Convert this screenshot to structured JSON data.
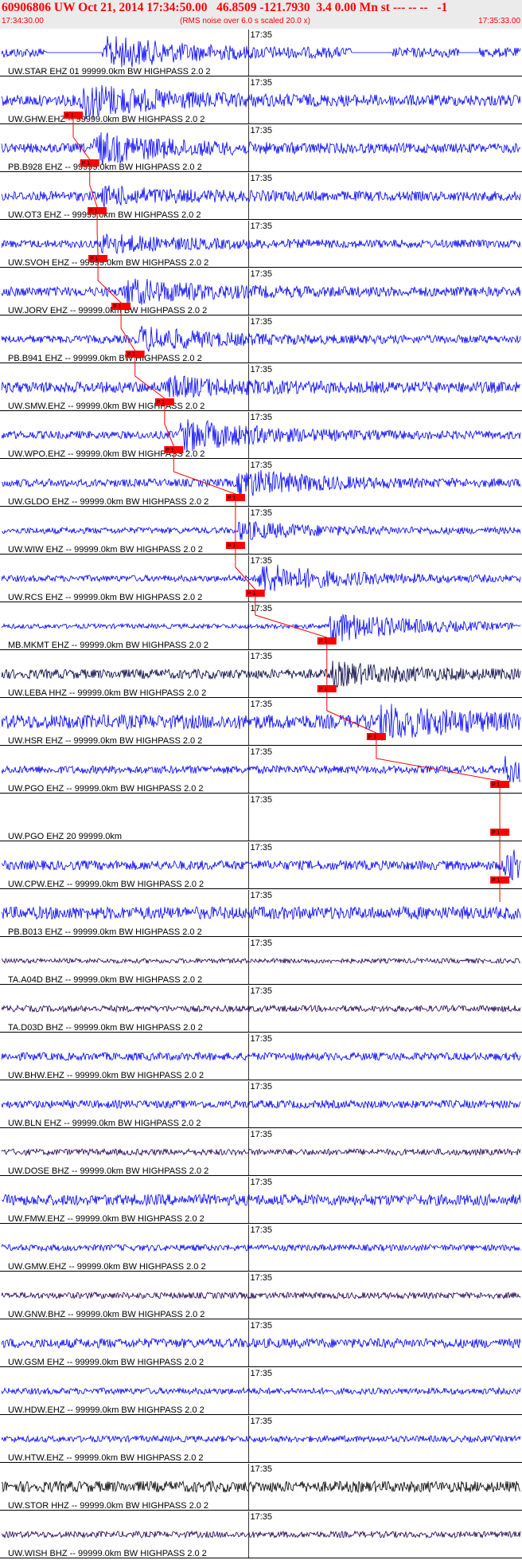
{
  "header": {
    "title": "60906806 UW Oct 21, 2014 17:34:50.00   46.8509 -121.7930  3.4 0.00 Mn st --- -- --   -1",
    "start_time": "17:34:30.00",
    "rms_note": "(RMS noise over 6.0 s scaled 20.0 x)",
    "end_time": "17:35:33.00"
  },
  "chart_data": {
    "type": "line",
    "time_range": [
      "17:34:30.00",
      "17:35:33.00"
    ],
    "time_mark": "17:35",
    "time_mark_offset_s": 30,
    "pick_marker": "P 1",
    "colors": {
      "trace_blue": "#0000ff",
      "trace_dark": "#000040",
      "trace_navy": "#200050",
      "pick": "#ff0000",
      "grid": "#000000"
    },
    "traces": [
      {
        "label": "UW.STAR EHZ 01 99999.0km BW  HIGHPASS  2.0  2",
        "pick_s": null,
        "onset_s": 12.5,
        "amp": 0.9,
        "noise": 0.3,
        "color": "#0000ff",
        "gaps": [
          [
            5.5,
            12.2
          ],
          [
            42.5,
            47.5
          ],
          [
            55.5,
            58
          ]
        ]
      },
      {
        "label": "UW.GHW.EHZ -- 99999.0km BW  HIGHPASS  2.0  2",
        "pick_s": 8.7,
        "onset_s": 9.5,
        "amp": 1.0,
        "noise": 0.35,
        "color": "#0000ff",
        "gaps": []
      },
      {
        "label": "PB.B928 EHZ -- 99999.0km BW  HIGHPASS  2.0  2",
        "pick_s": 10.7,
        "onset_s": 11.0,
        "amp": 0.9,
        "noise": 0.3,
        "color": "#0000ff",
        "gaps": []
      },
      {
        "label": "UW.OT3 EHZ -- 99999.0km BW  HIGHPASS  2.0  2",
        "pick_s": 11.6,
        "onset_s": 12.0,
        "amp": 0.45,
        "noise": 0.3,
        "color": "#0000ff",
        "gaps": []
      },
      {
        "label": "UW.SVOH EHZ -- 99999.0km BW  HIGHPASS  2.0  2",
        "pick_s": 11.7,
        "onset_s": 11.9,
        "amp": 0.5,
        "noise": 0.25,
        "color": "#0000ff",
        "gaps": []
      },
      {
        "label": "UW.JORV EHZ -- 99999.0km BW  HIGHPASS  2.0  2",
        "pick_s": 14.5,
        "onset_s": 14.7,
        "amp": 0.7,
        "noise": 0.3,
        "color": "#0000ff",
        "gaps": []
      },
      {
        "label": "PB.B941 EHZ -- 99999.0km BW  HIGHPASS  2.0  2",
        "pick_s": 16.2,
        "onset_s": 16.5,
        "amp": 0.7,
        "noise": 0.25,
        "color": "#0000ff",
        "gaps": []
      },
      {
        "label": "UW.SMW.EHZ -- 99999.0km BW  HIGHPASS  2.0  2",
        "pick_s": 19.8,
        "onset_s": 20.0,
        "amp": 0.45,
        "noise": 0.35,
        "color": "#0000ff",
        "gaps": []
      },
      {
        "label": "UW.WPO.EHZ -- 99999.0km BW  HIGHPASS  2.0  2",
        "pick_s": 20.9,
        "onset_s": 21.5,
        "amp": 0.95,
        "noise": 0.25,
        "color": "#0000ff",
        "gaps": []
      },
      {
        "label": "UW.GLDO EHZ -- 99999.0km BW  HIGHPASS  2.0  2",
        "pick_s": 28.4,
        "onset_s": 28.5,
        "amp": 0.8,
        "noise": 0.25,
        "color": "#0000ff",
        "gaps": []
      },
      {
        "label": "UW.WIW EHZ -- 99999.0km BW  HIGHPASS  2.0  2",
        "pick_s": 28.4,
        "onset_s": 28.5,
        "amp": 0.5,
        "noise": 0.2,
        "color": "#0000ff",
        "gaps": []
      },
      {
        "label": "UW.RCS EHZ -- 99999.0km BW  HIGHPASS  2.0  2",
        "pick_s": 30.8,
        "onset_s": 31.0,
        "amp": 0.9,
        "noise": 0.2,
        "color": "#0000ff",
        "gaps": []
      },
      {
        "label": "MB.MKMT EHZ -- 99999.0km BW  HIGHPASS  2.0  2",
        "pick_s": 39.5,
        "onset_s": 39.7,
        "amp": 1.0,
        "noise": 0.15,
        "color": "#0000ff",
        "gaps": []
      },
      {
        "label": "UW.LEBA HHZ -- 99999.0km BW  HIGHPASS  2.0  2",
        "pick_s": 39.5,
        "onset_s": 39.7,
        "amp": 0.6,
        "noise": 0.3,
        "color": "#000040",
        "gaps": []
      },
      {
        "label": "UW.HSR EHZ -- 99999.0km BW  HIGHPASS  2.0  2",
        "pick_s": 45.5,
        "onset_s": 45.8,
        "amp": 0.9,
        "noise": 0.45,
        "color": "#0000ff",
        "gaps": []
      },
      {
        "label": "UW.PGO EHZ -- 99999.0km BW  HIGHPASS  2.0  2",
        "pick_s": 60.5,
        "onset_s": 60.8,
        "amp": 0.7,
        "noise": 0.25,
        "color": "#0000ff",
        "gaps": []
      },
      {
        "label": "UW.PGO EHZ 20 99999.0km",
        "pick_s": 60.5,
        "onset_s": null,
        "amp": 0,
        "noise": 0,
        "color": "#0000ff",
        "gaps": []
      },
      {
        "label": "UW.CPW.EHZ -- 99999.0km BW  HIGHPASS  2.0  2",
        "pick_s": 60.5,
        "onset_s": 60.8,
        "amp": 0.8,
        "noise": 0.3,
        "color": "#0000ff",
        "gaps": []
      },
      {
        "label": "PB.B013 EHZ -- 99999.0km BW  HIGHPASS  2.0  2",
        "pick_s": null,
        "onset_s": null,
        "amp": 0,
        "noise": 0.4,
        "color": "#0000ff",
        "gaps": []
      },
      {
        "label": "TA.A04D BHZ -- 99999.0km BW  HIGHPASS  2.0  2",
        "pick_s": null,
        "onset_s": null,
        "amp": 0,
        "noise": 0.15,
        "color": "#200050",
        "gaps": []
      },
      {
        "label": "TA.D03D BHZ -- 99999.0km BW  HIGHPASS  2.0  2",
        "pick_s": null,
        "onset_s": null,
        "amp": 0,
        "noise": 0.2,
        "color": "#200050",
        "gaps": []
      },
      {
        "label": "UW.BHW.EHZ -- 99999.0km BW  HIGHPASS  2.0  2",
        "pick_s": null,
        "onset_s": null,
        "amp": 0,
        "noise": 0.25,
        "color": "#0000ff",
        "gaps": []
      },
      {
        "label": "UW.BLN EHZ -- 99999.0km BW  HIGHPASS  2.0  2",
        "pick_s": null,
        "onset_s": null,
        "amp": 0,
        "noise": 0.25,
        "color": "#0000ff",
        "gaps": []
      },
      {
        "label": "UW.DOSE BHZ -- 99999.0km BW  HIGHPASS  2.0  2",
        "pick_s": null,
        "onset_s": null,
        "amp": 0,
        "noise": 0.2,
        "color": "#200050",
        "gaps": []
      },
      {
        "label": "UW.FMW.EHZ -- 99999.0km BW  HIGHPASS  2.0  2",
        "pick_s": null,
        "onset_s": null,
        "amp": 0,
        "noise": 0.35,
        "color": "#0000ff",
        "gaps": []
      },
      {
        "label": "UW.GMW.EHZ -- 99999.0km BW  HIGHPASS  2.0  2",
        "pick_s": null,
        "onset_s": null,
        "amp": 0,
        "noise": 0.2,
        "color": "#0000ff",
        "gaps": []
      },
      {
        "label": "UW.GNW.BHZ -- 99999.0km BW  HIGHPASS  2.0  2",
        "pick_s": null,
        "onset_s": null,
        "amp": 0,
        "noise": 0.2,
        "color": "#200050",
        "gaps": []
      },
      {
        "label": "UW.GSM EHZ -- 99999.0km BW  HIGHPASS  2.0  2",
        "pick_s": null,
        "onset_s": null,
        "amp": 0,
        "noise": 0.3,
        "color": "#0000ff",
        "gaps": []
      },
      {
        "label": "UW.HDW.EHZ -- 99999.0km BW  HIGHPASS  2.0  2",
        "pick_s": null,
        "onset_s": null,
        "amp": 0,
        "noise": 0.2,
        "color": "#0000ff",
        "gaps": []
      },
      {
        "label": "UW.HTW.EHZ -- 99999.0km BW  HIGHPASS  2.0  2",
        "pick_s": null,
        "onset_s": null,
        "amp": 0,
        "noise": 0.2,
        "color": "#0000ff",
        "gaps": []
      },
      {
        "label": "UW.STOR HHZ -- 99999.0km BW  HIGHPASS  2.0  2",
        "pick_s": null,
        "onset_s": null,
        "amp": 0,
        "noise": 0.35,
        "color": "#000000",
        "gaps": []
      },
      {
        "label": "UW.WISH BHZ -- 99999.0km BW  HIGHPASS  2.0  2",
        "pick_s": null,
        "onset_s": null,
        "amp": 0,
        "noise": 0.2,
        "color": "#200050",
        "gaps": []
      }
    ]
  }
}
